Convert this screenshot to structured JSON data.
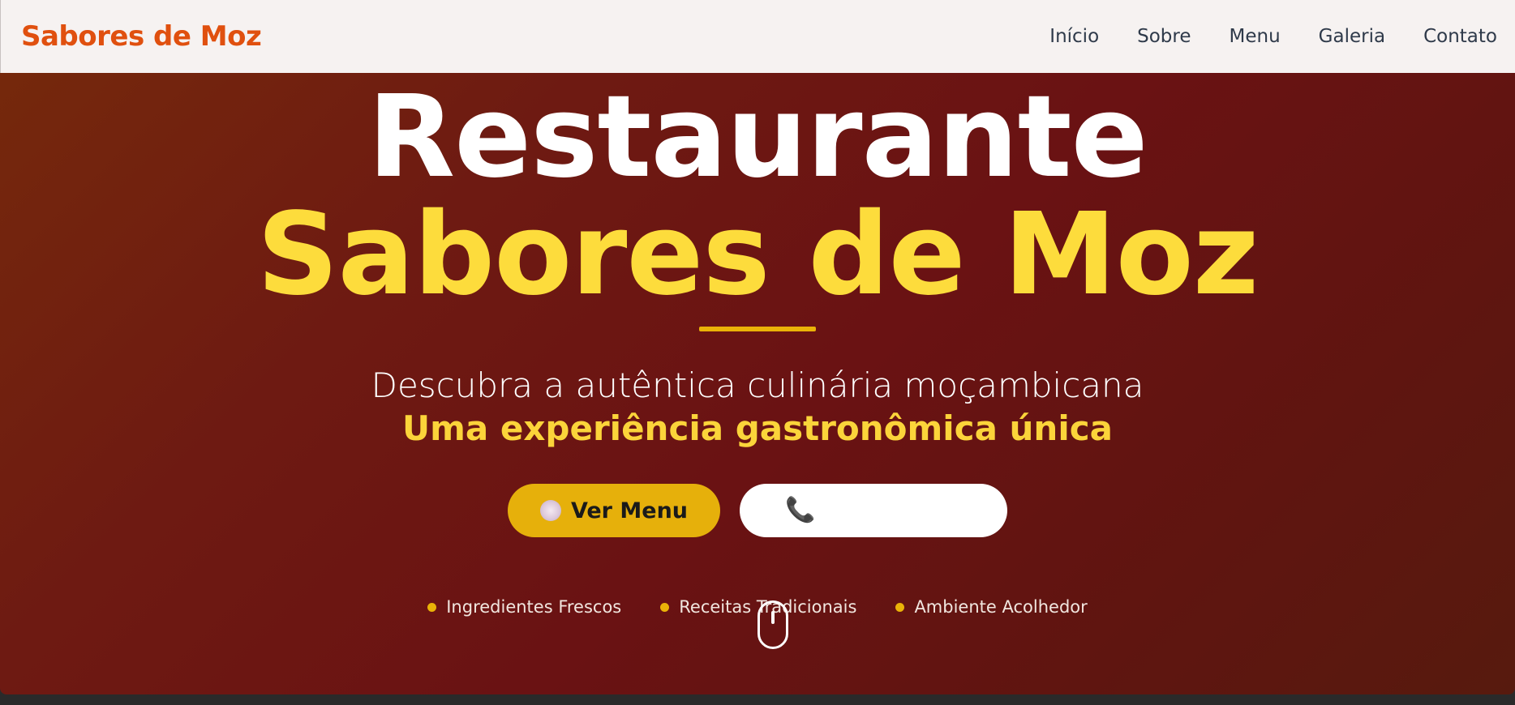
{
  "nav": {
    "brand": "Sabores de Moz",
    "links": [
      "Início",
      "Sobre",
      "Menu",
      "Galeria",
      "Contato"
    ]
  },
  "hero": {
    "title_line1": "Restaurante",
    "title_line2": "Sabores de Moz",
    "subtitle": "Descubra a autêntica culinária moçambicana",
    "tagline": "Uma experiência gastronômica única",
    "buttons": {
      "menu_label": "Ver Menu",
      "menu_icon": "plate-icon",
      "call_icon": "phone-icon"
    },
    "features": [
      "Ingredientes Frescos",
      "Receitas Tradicionais",
      "Ambiente Acolhedor"
    ]
  },
  "colors": {
    "brand": "#e0500f",
    "accent_yellow": "#fddc3c",
    "button_yellow": "#e6b00b",
    "hero_background": "#6a1213",
    "navbar_background": "#f6f2f1"
  }
}
